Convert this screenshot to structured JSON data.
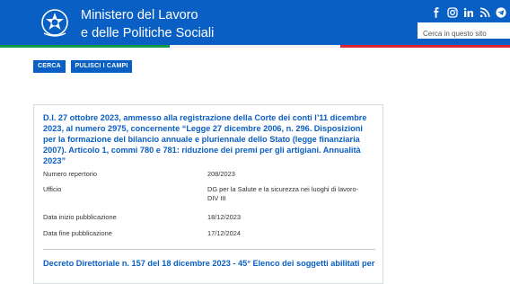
{
  "header": {
    "title_line1": "Ministero del Lavoro",
    "title_line2": "e delle Politiche Sociali",
    "search_placeholder": "Cerca in questo sito",
    "social_icons": [
      "facebook-icon",
      "instagram-icon",
      "linkedin-icon",
      "rss-icon",
      "telegram-icon"
    ]
  },
  "actions": {
    "search_label": "CERCA",
    "clear_label": "PULISCI I CAMPI"
  },
  "results": [
    {
      "title": "D.I. 27 ottobre 2023, ammesso alla registrazione della Corte dei conti l’11 dicembre 2023, al numero 2975, concernente “Legge 27 dicembre 2006, n. 296. Disposizioni per la formazione del bilancio annuale e pluriennale dello Stato (legge finanziaria 2007). Articolo 1, commi 780 e 781: riduzione dei premi per gli artigiani. Annualità 2023”",
      "fields": [
        {
          "label": "Numero repertorio",
          "value": "208/2023"
        },
        {
          "label": "Ufficio",
          "value": "DG per la Salute e la sicurezza nei luoghi di lavoro-DIV III"
        },
        {
          "label": "Data inizio pubblicazione",
          "value": "18/12/2023"
        },
        {
          "label": "Data fine pubblicazione",
          "value": "17/12/2024"
        }
      ]
    },
    {
      "title": "Decreto Direttoriale n. 157 del 18 dicembre 2023 - 45° Elenco dei soggetti abilitati per"
    }
  ],
  "colors": {
    "brand_blue": "#0a5fc4",
    "flag_green": "#0e9a48",
    "flag_red": "#d7262f"
  }
}
